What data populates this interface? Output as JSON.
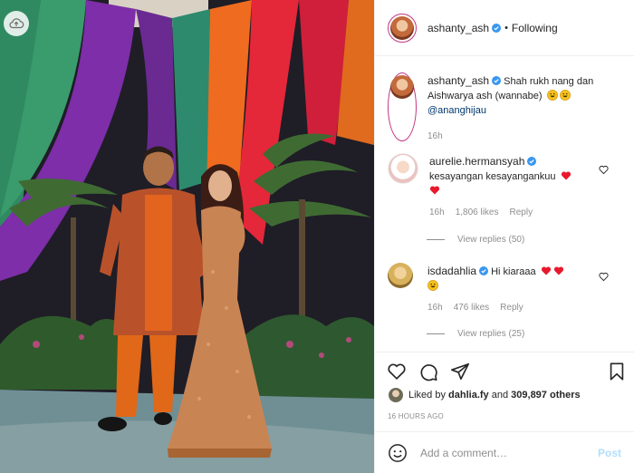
{
  "post": {
    "owner": "ashanty_ash",
    "follow_status": "Following",
    "separator": "•"
  },
  "caption": {
    "username": "ashanty_ash",
    "text": "Shah rukh nang dan Aishwarya ash (wannabe)",
    "mention": "@ananghijau",
    "emojis": [
      "grinning-face",
      "grinning-face"
    ],
    "time": "16h"
  },
  "comments": [
    {
      "username": "aurelie.hermansyah",
      "text": "kesayangan kesayangankuu",
      "emojis": [
        "red-heart",
        "red-heart"
      ],
      "time": "16h",
      "likes": "1,806 likes",
      "reply": "Reply",
      "view_replies": "View replies (50)"
    },
    {
      "username": "isdadahlia",
      "text": "Hi kiaraaa",
      "emojis": [
        "red-heart",
        "red-heart",
        "grinning-face"
      ],
      "time": "16h",
      "likes": "476 likes",
      "reply": "Reply",
      "view_replies": "View replies (25)"
    }
  ],
  "liked_by": {
    "prefix": "Liked by",
    "user": "dahlia.fy",
    "middle": "and",
    "others": "309,897 others"
  },
  "timestamp": "16 HOURS AGO",
  "comment_box": {
    "placeholder": "Add a comment…",
    "post_label": "Post"
  },
  "colors": {
    "link": "#00376b",
    "muted": "#8e8e8e",
    "verified": "#3897f0",
    "heart": "#ed4956",
    "post_disabled": "#b2dffc"
  },
  "icons": [
    "heart-icon",
    "comment-icon",
    "share-icon",
    "bookmark-icon",
    "smiley-icon",
    "verified-icon",
    "cloud-upload-icon"
  ]
}
